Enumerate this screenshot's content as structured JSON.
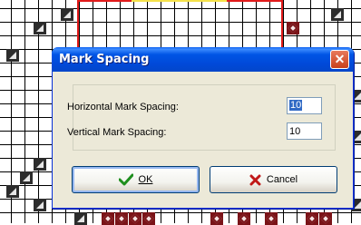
{
  "dialog": {
    "title": "Mark Spacing",
    "close_glyph": "✕",
    "fields": {
      "horizontal": {
        "label": "Horizontal Mark Spacing:",
        "value": "10"
      },
      "vertical": {
        "label": "Vertical Mark Spacing:",
        "value": "10"
      }
    },
    "buttons": {
      "ok": {
        "label": "OK",
        "icon": "check-icon"
      },
      "cancel": {
        "label": "Cancel",
        "icon": "x-icon"
      }
    }
  },
  "colors": {
    "titlebar": "#0055e5",
    "dialog_bg": "#ece9d8",
    "marked_tile": "#7a1318",
    "selection": "#316ac5"
  }
}
